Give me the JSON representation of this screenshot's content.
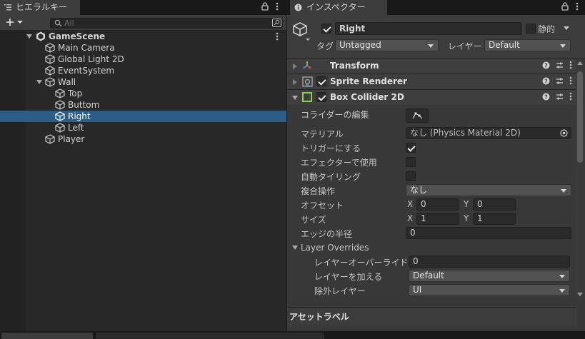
{
  "hierarchy": {
    "tab_label": "ヒエラルキー",
    "search_placeholder": "All",
    "scene_name": "GameScene",
    "items": [
      {
        "label": "Main Camera"
      },
      {
        "label": "Global Light 2D"
      },
      {
        "label": "EventSystem"
      },
      {
        "label": "Wall"
      },
      {
        "label": "Top"
      },
      {
        "label": "Buttom"
      },
      {
        "label": "Right"
      },
      {
        "label": "Left"
      },
      {
        "label": "Player"
      }
    ],
    "selected_item": "Right"
  },
  "inspector": {
    "tab_label": "インスペクター",
    "object_name": "Right",
    "static_label": "静的",
    "tag_label": "タグ",
    "tag_value": "Untagged",
    "layer_label": "レイヤー",
    "layer_value": "Default",
    "components": [
      {
        "name": "Transform"
      },
      {
        "name": "Sprite Renderer"
      },
      {
        "name": "Box Collider 2D"
      }
    ],
    "box_collider": {
      "edit_collider_label": "コライダーの編集",
      "material_label": "マテリアル",
      "material_value": "なし (Physics Material 2D)",
      "trigger_label": "トリガーにする",
      "effector_label": "エフェクターで使用",
      "autotiling_label": "自動タイリング",
      "composite_label": "複合操作",
      "composite_value": "なし",
      "offset_label": "オフセット",
      "offset_x": "0",
      "offset_y": "0",
      "size_label": "サイズ",
      "size_x": "1",
      "size_y": "1",
      "edge_radius_label": "エッジの半径",
      "edge_radius_value": "0",
      "x_label": "X",
      "y_label": "Y",
      "layer_overrides_label": "Layer Overrides",
      "layer_override_priority_label": "レイヤーオーバーライド",
      "layer_override_priority_value": "0",
      "include_layers_label": "レイヤーを加える",
      "include_layers_value": "Default",
      "exclude_layers_label": "除外レイヤー",
      "exclude_layers_value": "UI"
    },
    "asset_label_title": "アセットラベル"
  },
  "colors": {
    "selection": "#2c5d87",
    "collider_icon": "#8cd14b"
  }
}
